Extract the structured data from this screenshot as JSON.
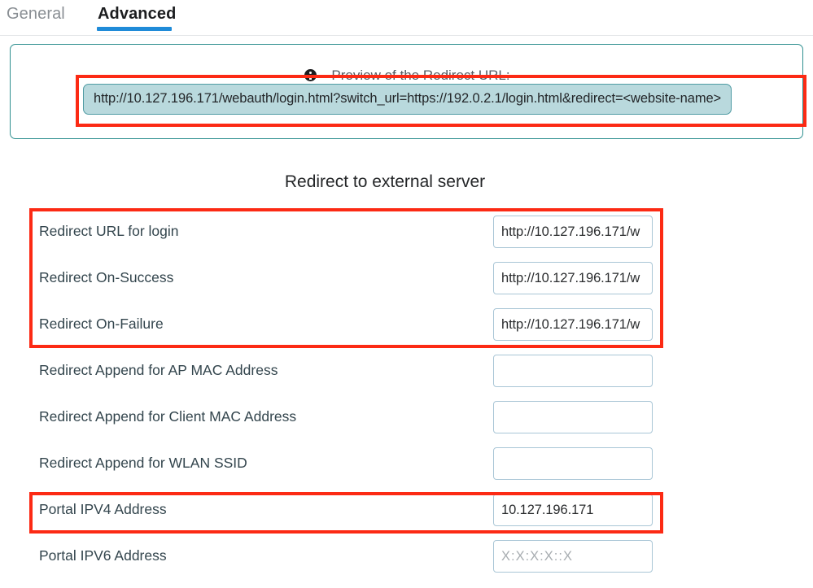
{
  "tabs": [
    {
      "label": "General",
      "active": false
    },
    {
      "label": "Advanced",
      "active": true
    }
  ],
  "preview": {
    "icon": "info-circle-icon",
    "label": "Preview of the Redirect URL:",
    "url": "http://10.127.196.171/webauth/login.html?switch_url=https://192.0.2.1/login.html&redirect=<website-name>",
    "panel_border_color": "#2e8f8f",
    "pill_background_color": "#b9d9dd",
    "pill_border_color": "#4f9ba3"
  },
  "section": {
    "heading": "Redirect to external server"
  },
  "fields": [
    {
      "label": "Redirect URL for login",
      "value": "http://10.127.196.171/w",
      "placeholder": ""
    },
    {
      "label": "Redirect On-Success",
      "value": "http://10.127.196.171/w",
      "placeholder": ""
    },
    {
      "label": "Redirect On-Failure",
      "value": "http://10.127.196.171/w",
      "placeholder": ""
    },
    {
      "label": "Redirect Append for AP MAC Address",
      "value": "",
      "placeholder": ""
    },
    {
      "label": "Redirect Append for Client MAC Address",
      "value": "",
      "placeholder": ""
    },
    {
      "label": "Redirect Append for WLAN SSID",
      "value": "",
      "placeholder": ""
    },
    {
      "label": "Portal IPV4 Address",
      "value": "10.127.196.171",
      "placeholder": ""
    },
    {
      "label": "Portal IPV6 Address",
      "value": "",
      "placeholder": "X:X:X:X::X"
    }
  ],
  "annotations": {
    "color": "#fc2a14",
    "regions": [
      "preview-url-highlight",
      "redirect-urls-highlight",
      "portal-ipv4-highlight"
    ]
  },
  "theme": {
    "active_tab_underline": "#1f8bd8",
    "label_text": "#33454d",
    "input_border": "#a9c6d6"
  }
}
